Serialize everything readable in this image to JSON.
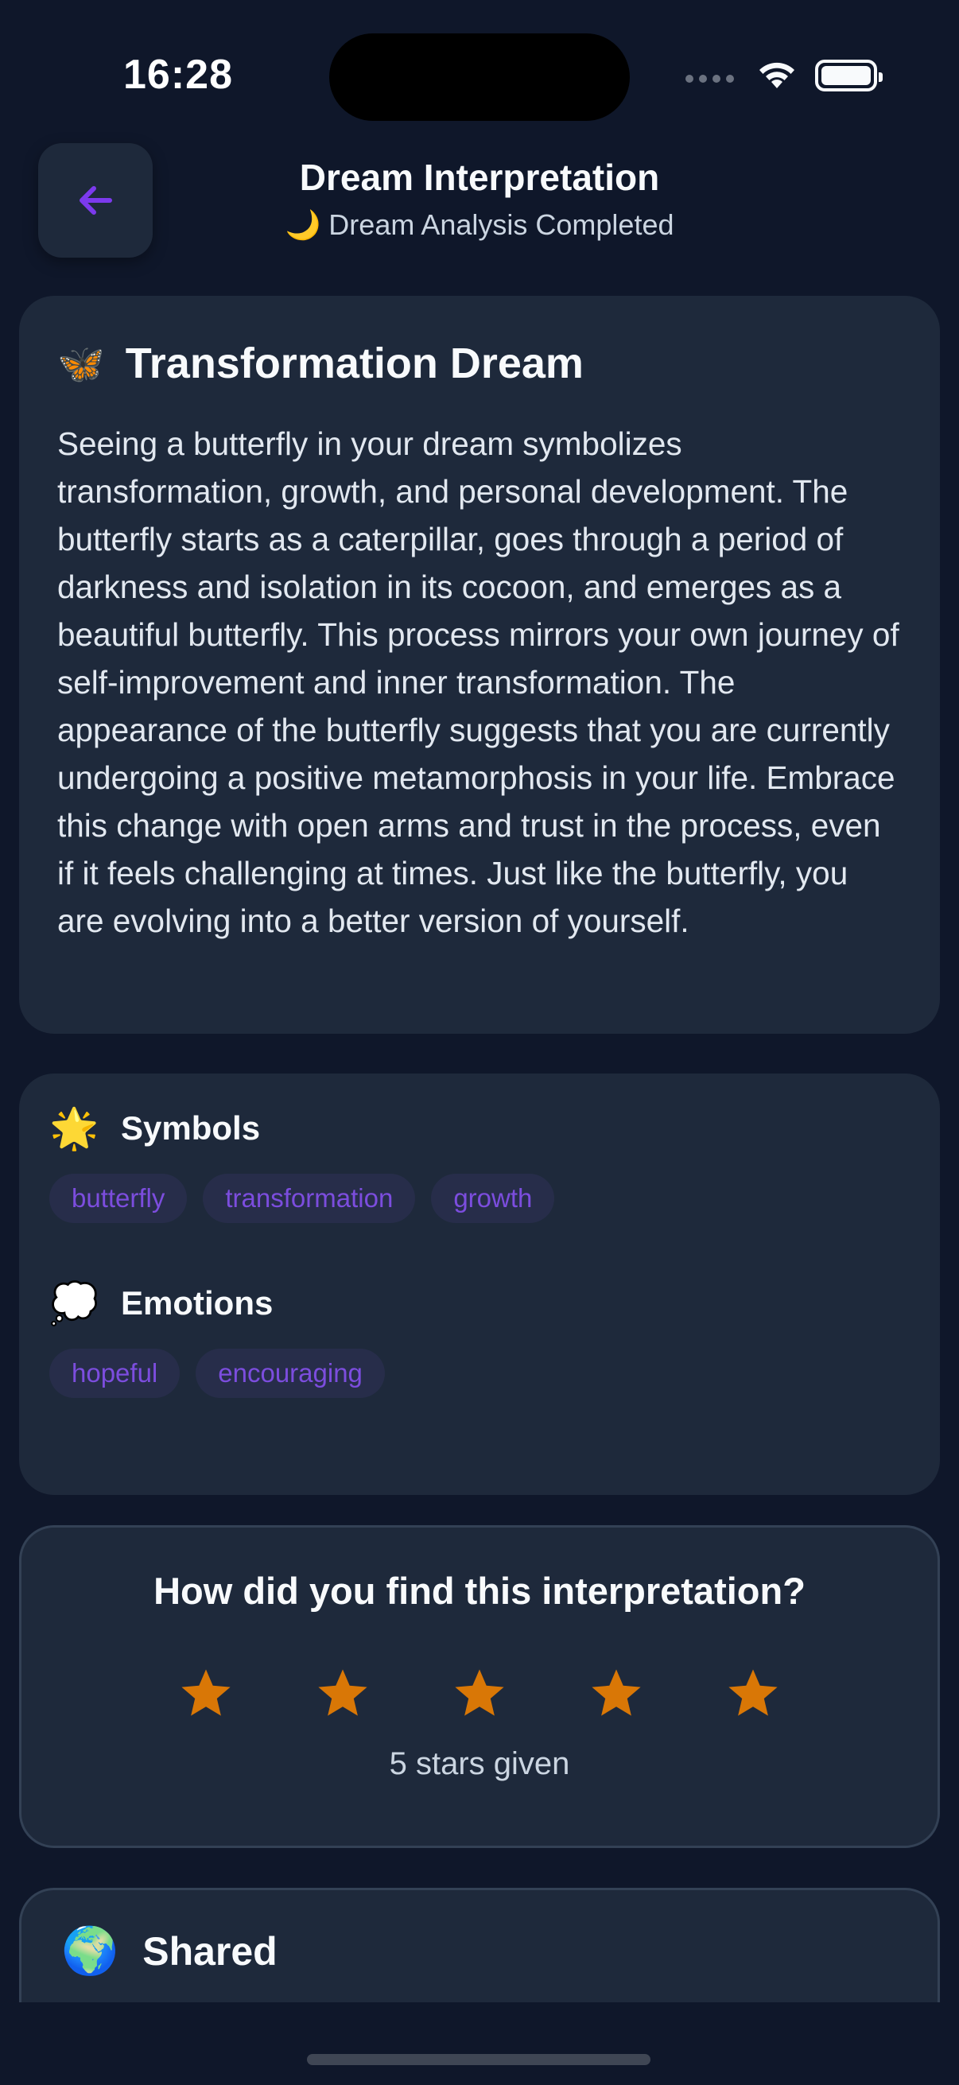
{
  "status_bar": {
    "time": "16:28"
  },
  "header": {
    "back_icon": "arrow-left-icon",
    "title": "Dream Interpretation",
    "subtitle": "🌙 Dream Analysis Completed"
  },
  "interpretation": {
    "emoji": "🦋",
    "title": "Transformation Dream",
    "text": "Seeing a butterfly in your dream symbolizes transformation, growth, and personal development. The butterfly starts as a caterpillar, goes through a period of darkness and isolation in its cocoon, and emerges as a beautiful butterfly. This process mirrors your own journey of self-improvement and inner transformation. The appearance of the butterfly suggests that you are currently undergoing a positive metamorphosis in your life. Embrace this change with open arms and trust in the process, even if it feels challenging at times. Just like the butterfly, you are evolving into a better version of yourself."
  },
  "symbols": {
    "emoji": "🌟",
    "title": "Symbols",
    "tags": [
      "butterfly",
      "transformation",
      "growth"
    ]
  },
  "emotions": {
    "emoji": "💭",
    "title": "Emotions",
    "tags": [
      "hopeful",
      "encouraging"
    ]
  },
  "rating": {
    "question": "How did you find this interpretation?",
    "stars_given": 5,
    "stars_total": 5,
    "caption": "5 stars given",
    "star_color": "#d97706"
  },
  "shared": {
    "emoji": "🌍",
    "title": "Shared"
  },
  "colors": {
    "background": "#0f172a",
    "card": "#1e293b",
    "accent": "#7c3aed",
    "chip_text": "#7c4dde"
  }
}
